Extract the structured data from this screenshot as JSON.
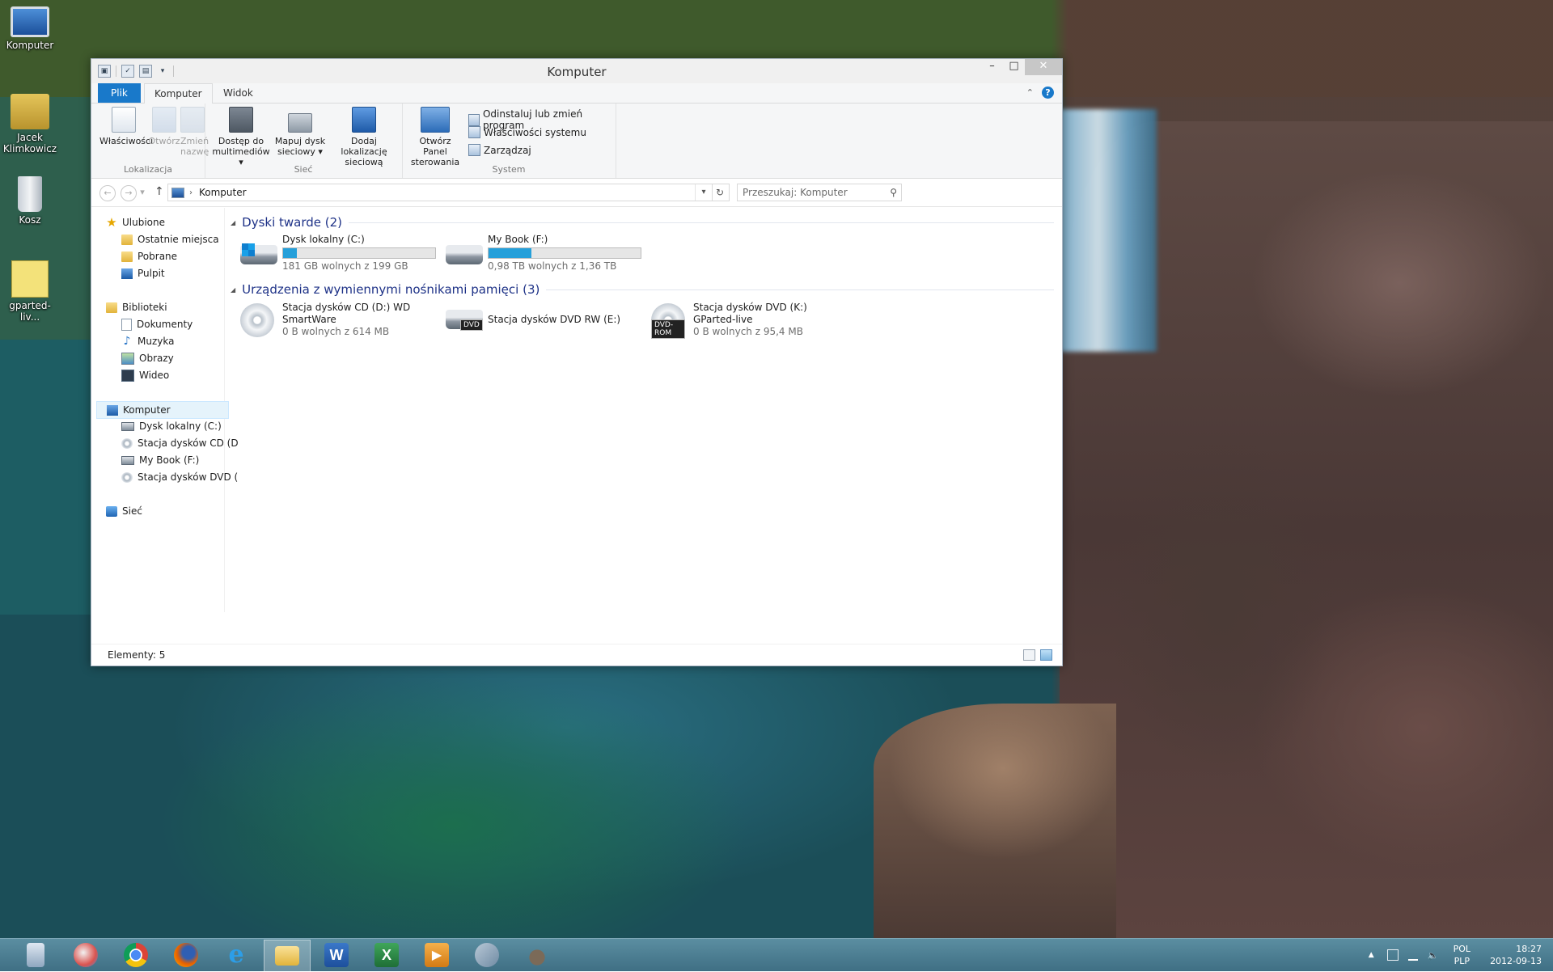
{
  "desktop": {
    "icons": [
      {
        "label": "Komputer"
      },
      {
        "label": "Jacek Klimkowicz"
      },
      {
        "label": "Kosz"
      },
      {
        "label": "gparted-liv..."
      }
    ]
  },
  "window": {
    "title": "Komputer",
    "tabs": {
      "file": "Plik",
      "computer": "Komputer",
      "view": "Widok"
    },
    "ribbon": {
      "location": {
        "label": "Lokalizacja",
        "properties": "Właściwości",
        "open": "Otwórz",
        "rename": "Zmień nazwę"
      },
      "network": {
        "label": "Sieć",
        "media_line1": "Dostęp do",
        "media_line2": "multimediów",
        "map_line1": "Mapuj dysk",
        "map_line2": "sieciowy",
        "add_line1": "Dodaj lokalizację",
        "add_line2": "sieciową"
      },
      "system": {
        "label": "System",
        "cp_line1": "Otwórz Panel",
        "cp_line2": "sterowania",
        "uninstall": "Odinstaluj lub zmień program",
        "sys_props": "Właściwości systemu",
        "manage": "Zarządzaj"
      }
    },
    "address": {
      "path": "Komputer",
      "search_placeholder": "Przeszukaj: Komputer"
    },
    "nav": {
      "favorites": "Ulubione",
      "recent": "Ostatnie miejsca",
      "downloads": "Pobrane",
      "desktop": "Pulpit",
      "libraries": "Biblioteki",
      "documents": "Dokumenty",
      "music": "Muzyka",
      "pictures": "Obrazy",
      "videos": "Wideo",
      "computer": "Komputer",
      "drive_c": "Dysk lokalny (C:)",
      "drive_cd": "Stacja dysków CD (D",
      "drive_f": "My Book (F:)",
      "drive_dvd": "Stacja dysków DVD (",
      "network": "Sieć"
    },
    "content": {
      "hdd_group": "Dyski twarde (2)",
      "removable_group": "Urządzenia z wymiennymi nośnikami pamięci (3)",
      "drives": [
        {
          "name": "Dysk lokalny (C:)",
          "free": "181 GB wolnych z 199 GB",
          "used_fraction": 0.09
        },
        {
          "name": "My Book (F:)",
          "free": "0,98 TB wolnych z 1,36 TB",
          "used_fraction": 0.28
        }
      ],
      "removable": [
        {
          "line1": "Stacja dysków CD (D:) WD",
          "line2": "SmartWare",
          "free": "0 B wolnych z 614 MB"
        },
        {
          "line1": "Stacja dysków DVD RW (E:)"
        },
        {
          "line1": "Stacja dysków DVD (K:)",
          "line2": "GParted-live",
          "free": "0 B wolnych z 95,4 MB",
          "badge": "DVD-ROM"
        }
      ],
      "dvd_badge": "DVD"
    },
    "status": {
      "items": "Elementy: 5"
    }
  },
  "taskbar": {
    "apps": [
      "calculator",
      "paint",
      "chrome",
      "firefox",
      "internet-explorer",
      "file-explorer",
      "word",
      "excel",
      "media-player",
      "tool",
      "gimp"
    ],
    "lang_line1": "POL",
    "lang_line2": "PLP",
    "time": "18:27",
    "date": "2012-09-13"
  }
}
